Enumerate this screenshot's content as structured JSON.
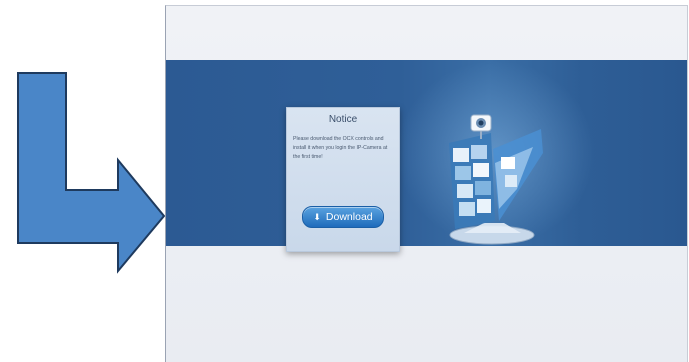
{
  "notice": {
    "title": "Notice",
    "message": "Please download the OCX controls and install it when you login the IP-Camera at the first time!",
    "download_label": "Download"
  },
  "icons": {
    "download": "arrow-down-icon",
    "decorative_arrow": "arrow-right-icon"
  },
  "colors": {
    "banner": "#2c5a93",
    "button": "#2f7fd0",
    "arrow_fill": "#4a86c8"
  }
}
